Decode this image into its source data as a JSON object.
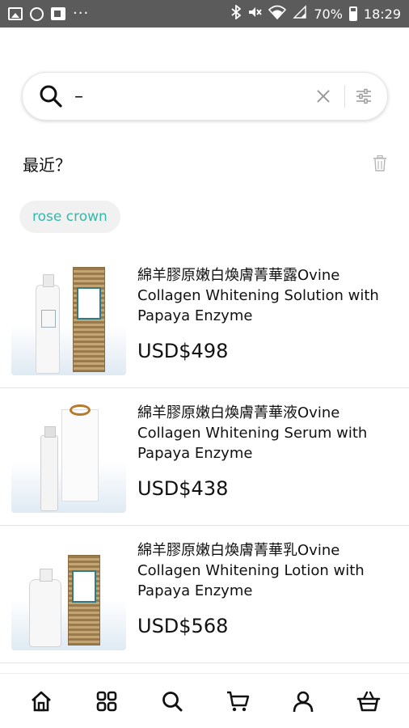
{
  "status_bar": {
    "icons": [
      "image-icon",
      "whatsapp-icon",
      "flipboard-icon",
      "more-icon",
      "bluetooth-icon",
      "mute-icon",
      "wifi-icon",
      "signal-icon",
      "battery-icon"
    ],
    "more": "···",
    "battery": "70%",
    "time": "18:29"
  },
  "search": {
    "value": "–",
    "placeholder": ""
  },
  "recent": {
    "title": "最近？",
    "chips": [
      "rose crown"
    ]
  },
  "products": [
    {
      "name": "綿羊膠原嫩白煥膚菁華露Ovine Collagen Whitening Solution with Papaya Enzyme",
      "price": "USD$498"
    },
    {
      "name": "綿羊膠原嫩白煥膚菁華液Ovine Collagen Whitening Serum with Papaya Enzyme",
      "price": "USD$438"
    },
    {
      "name": "綿羊膠原嫩白煥膚菁華乳Ovine Collagen Whitening Lotion with Papaya Enzyme",
      "price": "USD$568"
    }
  ],
  "bottom_nav": [
    "home-icon",
    "grid-icon",
    "search-icon",
    "cart-icon",
    "user-icon",
    "basket-icon"
  ],
  "colors": {
    "accent_teal": "#37b7a8",
    "status_bar": "#5b5b5b"
  }
}
